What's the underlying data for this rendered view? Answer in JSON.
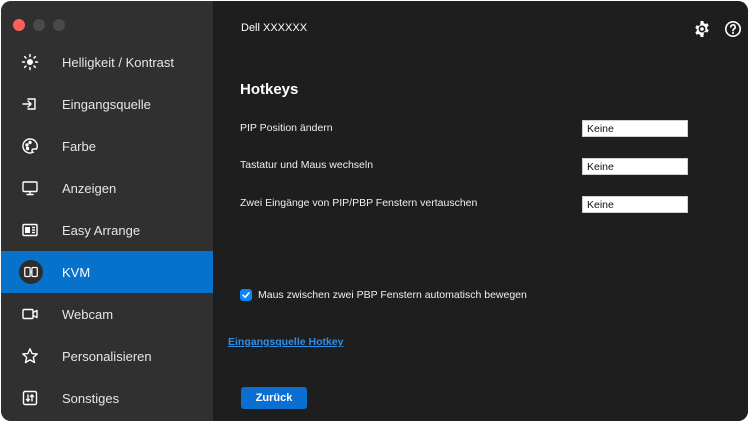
{
  "window": {
    "title": "Dell XXXXXX"
  },
  "sidebar": {
    "items": [
      {
        "label": "Helligkeit / Kontrast",
        "icon": "brightness-icon",
        "active": false
      },
      {
        "label": "Eingangsquelle",
        "icon": "input-source-icon",
        "active": false
      },
      {
        "label": "Farbe",
        "icon": "color-icon",
        "active": false
      },
      {
        "label": "Anzeigen",
        "icon": "display-icon",
        "active": false
      },
      {
        "label": "Easy Arrange",
        "icon": "easy-arrange-icon",
        "active": false
      },
      {
        "label": "KVM",
        "icon": "kvm-icon",
        "active": true
      },
      {
        "label": "Webcam",
        "icon": "webcam-icon",
        "active": false
      },
      {
        "label": "Personalisieren",
        "icon": "star-icon",
        "active": false
      },
      {
        "label": "Sonstiges",
        "icon": "others-icon",
        "active": false
      }
    ]
  },
  "main": {
    "heading": "Hotkeys",
    "rows": [
      {
        "label": "PIP Position ändern",
        "value": "Keine"
      },
      {
        "label": "Tastatur und Maus wechseln",
        "value": "Keine"
      },
      {
        "label": "Zwei Eingänge von PIP/PBP Fenstern vertauschen",
        "value": "Keine"
      }
    ],
    "checkbox": {
      "label": "Maus zwischen zwei PBP Fenstern automatisch bewegen",
      "checked": true
    },
    "link": "Eingangsquelle Hotkey",
    "back_button": "Zurück"
  },
  "colors": {
    "accent": "#0672cb",
    "sidebar_bg": "#303030",
    "main_bg": "#1e1e1e",
    "link": "#2f8fe8"
  }
}
